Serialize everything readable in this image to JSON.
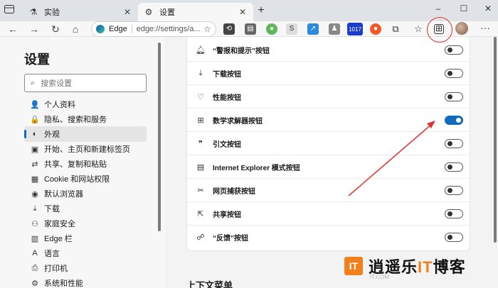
{
  "tabs": [
    {
      "label": "实验",
      "icon": "flask-icon",
      "active": false
    },
    {
      "label": "设置",
      "icon": "gear-icon",
      "active": true
    }
  ],
  "window_controls": [
    "–",
    "☐",
    "✕"
  ],
  "address": {
    "brand": "Edge",
    "url": "edge://settings/a..."
  },
  "extensions_badge": "1017",
  "sidebar": {
    "title": "设置",
    "search_placeholder": "搜索设置",
    "items": [
      {
        "label": "个人资料",
        "icon": "person-icon"
      },
      {
        "label": "隐私、搜索和服务",
        "icon": "lock-icon"
      },
      {
        "label": "外观",
        "icon": "appearance-icon",
        "selected": true
      },
      {
        "label": "开始、主页和新建标签页",
        "icon": "home-tabs-icon"
      },
      {
        "label": "共享、复制和粘贴",
        "icon": "share-icon"
      },
      {
        "label": "Cookie 和网站权限",
        "icon": "cookie-icon"
      },
      {
        "label": "默认浏览器",
        "icon": "browser-icon"
      },
      {
        "label": "下载",
        "icon": "download-icon"
      },
      {
        "label": "家庭安全",
        "icon": "family-icon"
      },
      {
        "label": "Edge 栏",
        "icon": "edge-bar-icon"
      },
      {
        "label": "语言",
        "icon": "language-icon"
      },
      {
        "label": "打印机",
        "icon": "printer-icon"
      },
      {
        "label": "系统和性能",
        "icon": "system-icon"
      }
    ]
  },
  "toolbar_buttons": [
    {
      "label": "“警报和提示”按钮",
      "icon": "bell-icon",
      "on": false
    },
    {
      "label": "下载按钮",
      "icon": "download-icon",
      "on": false
    },
    {
      "label": "性能按钮",
      "icon": "heartbeat-icon",
      "on": false
    },
    {
      "label": "数学求解器按钮",
      "icon": "math-solver-icon",
      "on": true
    },
    {
      "label": "引文按钮",
      "icon": "quote-icon",
      "on": false
    },
    {
      "label": "Internet Explorer 模式按钮",
      "icon": "ie-mode-icon",
      "on": false
    },
    {
      "label": "网页捕获按钮",
      "icon": "capture-icon",
      "on": false
    },
    {
      "label": "共享按钮",
      "icon": "share-icon",
      "on": false
    },
    {
      "label": "“反馈”按钮",
      "icon": "feedback-icon",
      "on": false
    }
  ],
  "next_section_title": "上下文菜单",
  "watermark": {
    "logo": "IT",
    "text_a": "逍遥乐",
    "text_b": "IT",
    "text_c": "博客",
    "sub": "IT.COM"
  },
  "colors": {
    "accent": "#0f6cbd",
    "annotation": "#e03232",
    "watermark": "#f07f1c"
  }
}
